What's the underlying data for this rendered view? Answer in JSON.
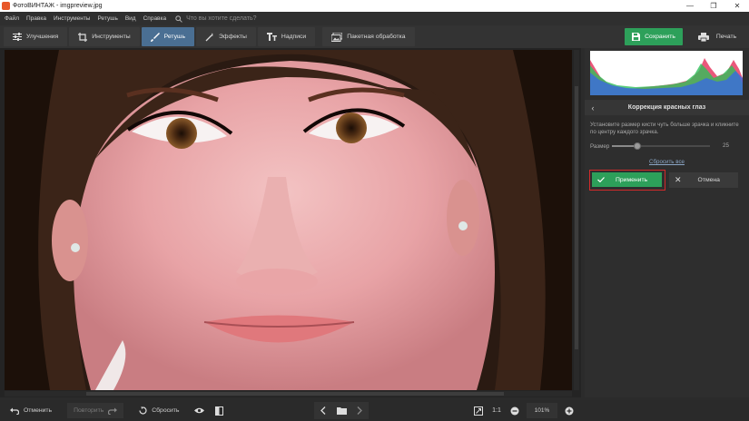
{
  "window": {
    "title": "ФотоВИНТАЖ - imgpreview.jpg"
  },
  "menu": {
    "items": [
      "Файл",
      "Правка",
      "Инструменты",
      "Ретушь",
      "Вид",
      "Справка"
    ],
    "search_placeholder": "Что вы хотите сделать?"
  },
  "toolbar": {
    "tabs": [
      {
        "label": "Улучшения",
        "icon": "sliders-icon"
      },
      {
        "label": "Инструменты",
        "icon": "crop-icon"
      },
      {
        "label": "Ретушь",
        "icon": "brush-icon",
        "active": true
      },
      {
        "label": "Эффекты",
        "icon": "magic-wand-icon"
      },
      {
        "label": "Надписи",
        "icon": "text-icon"
      }
    ],
    "batch_label": "Пакетная обработка",
    "save_label": "Сохранить",
    "print_label": "Печать"
  },
  "panel": {
    "title": "Коррекция красных глаз",
    "hint": "Установите размер кисти чуть больше зрачка и кликните по центру каждого зрачка.",
    "size_label": "Размер",
    "size_value": "25",
    "size_fraction": 0.26,
    "reset_all": "Сбросить все",
    "apply_label": "Применить",
    "cancel_label": "Отмена"
  },
  "bottom": {
    "undo_label": "Отменить",
    "redo_label": "Повторить",
    "reset_label": "Сбросить",
    "ratio_label": "1:1",
    "zoom_value": "101%"
  },
  "colors": {
    "accent_green": "#2da05a",
    "active_tab": "#4a6f93",
    "apply_highlight": "#d32a2a"
  }
}
